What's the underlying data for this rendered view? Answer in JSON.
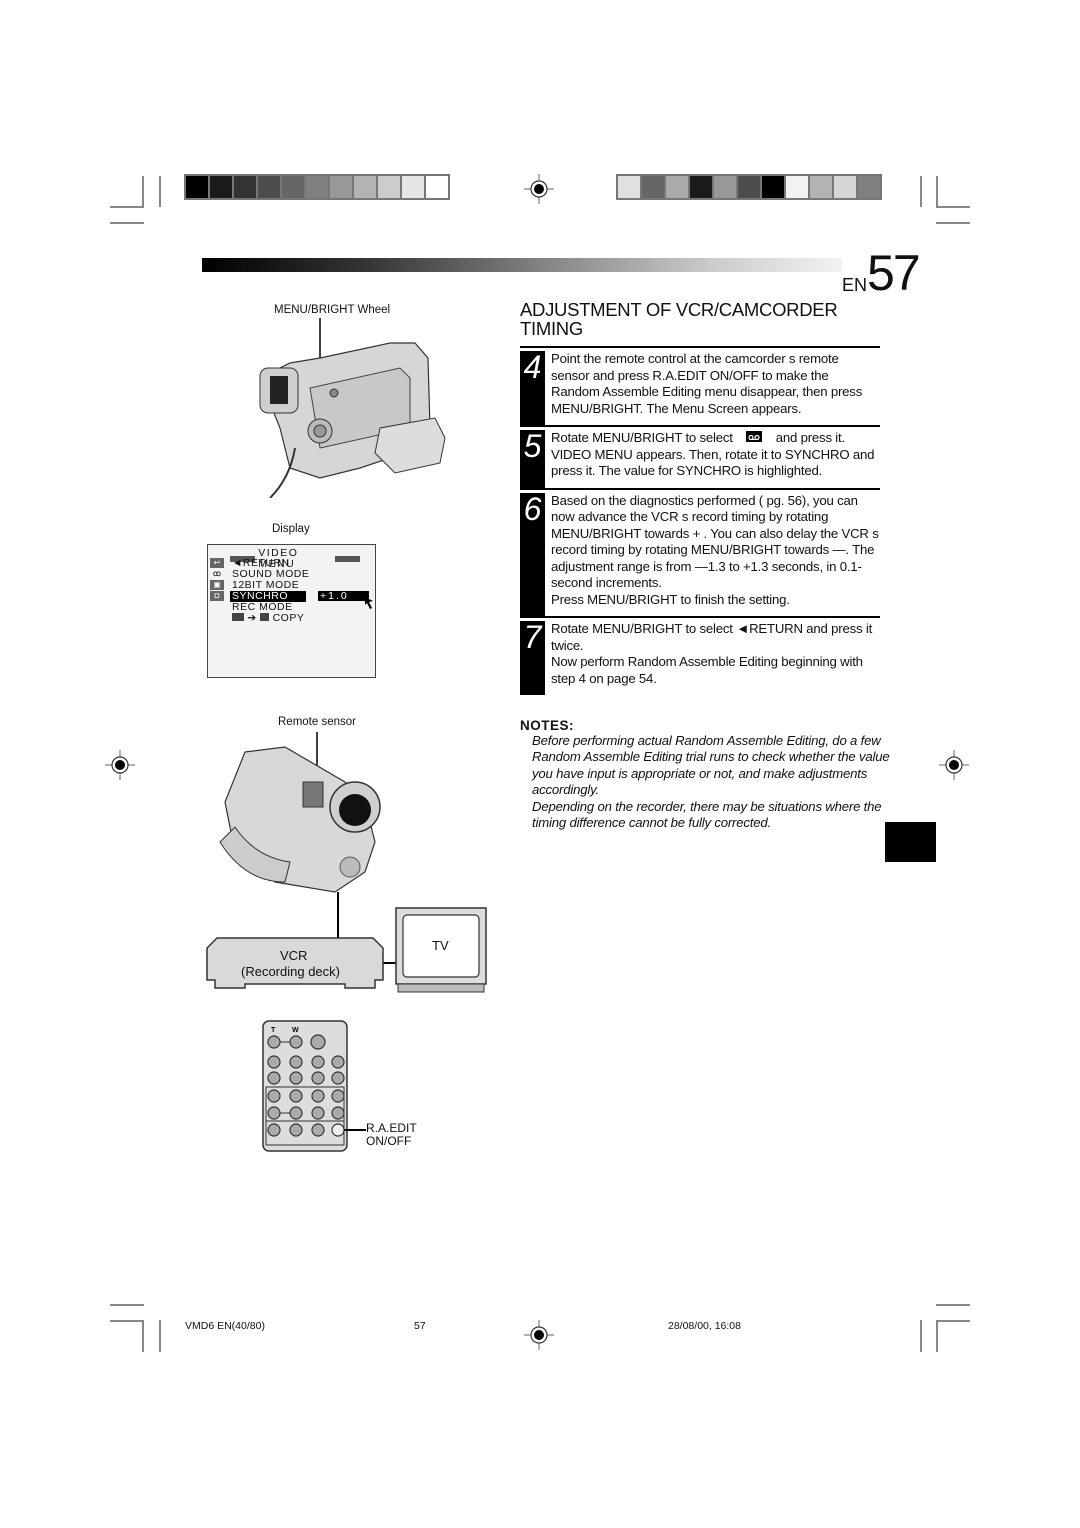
{
  "header": {
    "page_prefix": "EN",
    "page_number": "57",
    "color_bar_left": [
      "#000000",
      "#1a1a1a",
      "#333333",
      "#4d4d4d",
      "#666666",
      "#808080",
      "#999999",
      "#b3b3b3",
      "#cccccc",
      "#e6e6e6",
      "#ffffff"
    ],
    "color_bar_right": [
      "#e0e0e0",
      "#666666",
      "#aaaaaa",
      "#1a1a1a",
      "#999999",
      "#4d4d4d",
      "#000000",
      "#f2f2f2",
      "#b3b3b3",
      "#d6d6d6",
      "#808080"
    ]
  },
  "title": "ADJUSTMENT OF VCR/CAMCORDER TIMING",
  "steps": [
    {
      "number": "4",
      "text": "Point the remote control at the camcorder s remote sensor and press R.A.EDIT ON/OFF to make the Random Assemble Editing menu disappear, then press MENU/BRIGHT. The Menu Screen appears."
    },
    {
      "number": "5",
      "text_before_icon": "Rotate MENU/BRIGHT to select",
      "icon": "video-tape-icon",
      "text_after_icon": "and press it.  VIDEO MENU  appears. Then, rotate it to  SYNCHRO  and press it. The value for  SYNCHRO is highlighted."
    },
    {
      "number": "6",
      "text": "Based on the diagnostics performed (     pg. 56), you can now advance the VCR s record timing by rotating MENU/BRIGHT towards  + . You can also delay the VCR s record timing by rotating MENU/BRIGHT towards  —. The adjustment range is from —1.3 to +1.3 seconds, in 0.1-second increments.",
      "text2": "Press MENU/BRIGHT to finish the setting."
    },
    {
      "number": "7",
      "text": "Rotate MENU/BRIGHT to select  ◄RETURN  and press it twice.",
      "text2": "Now perform Random Assemble Editing beginning with step 4 on page 54."
    }
  ],
  "notes": {
    "heading": "NOTES:",
    "items": [
      "Before performing actual Random Assemble Editing, do a few Random Assemble Editing trial runs to check whether the value you have input is appropriate or not, and make adjustments accordingly.",
      "Depending on the recorder, there may be situations where the timing difference cannot be fully corrected."
    ]
  },
  "figures": {
    "camcorder_label": "MENU/BRIGHT Wheel",
    "display_label": "Display",
    "display_menu": {
      "title": "VIDEO MENU",
      "items": [
        "◄RETURN",
        "SOUND MODE",
        "12BIT MODE",
        "SYNCHRO",
        "REC MODE",
        "COPY"
      ],
      "selected": "SYNCHRO",
      "value": "+1.0"
    },
    "remote_sensor_label": "Remote sensor",
    "vcr_label": "VCR",
    "vcr_sublabel": "(Recording deck)",
    "tv_label": "TV",
    "remote_t": "T",
    "remote_w": "W",
    "remote_button_label_1": "R.A.EDIT",
    "remote_button_label_2": "ON/OFF"
  },
  "footer": {
    "file": "VMD6 EN(40/80)",
    "page": "57",
    "date": "28/08/00, 16:08"
  }
}
